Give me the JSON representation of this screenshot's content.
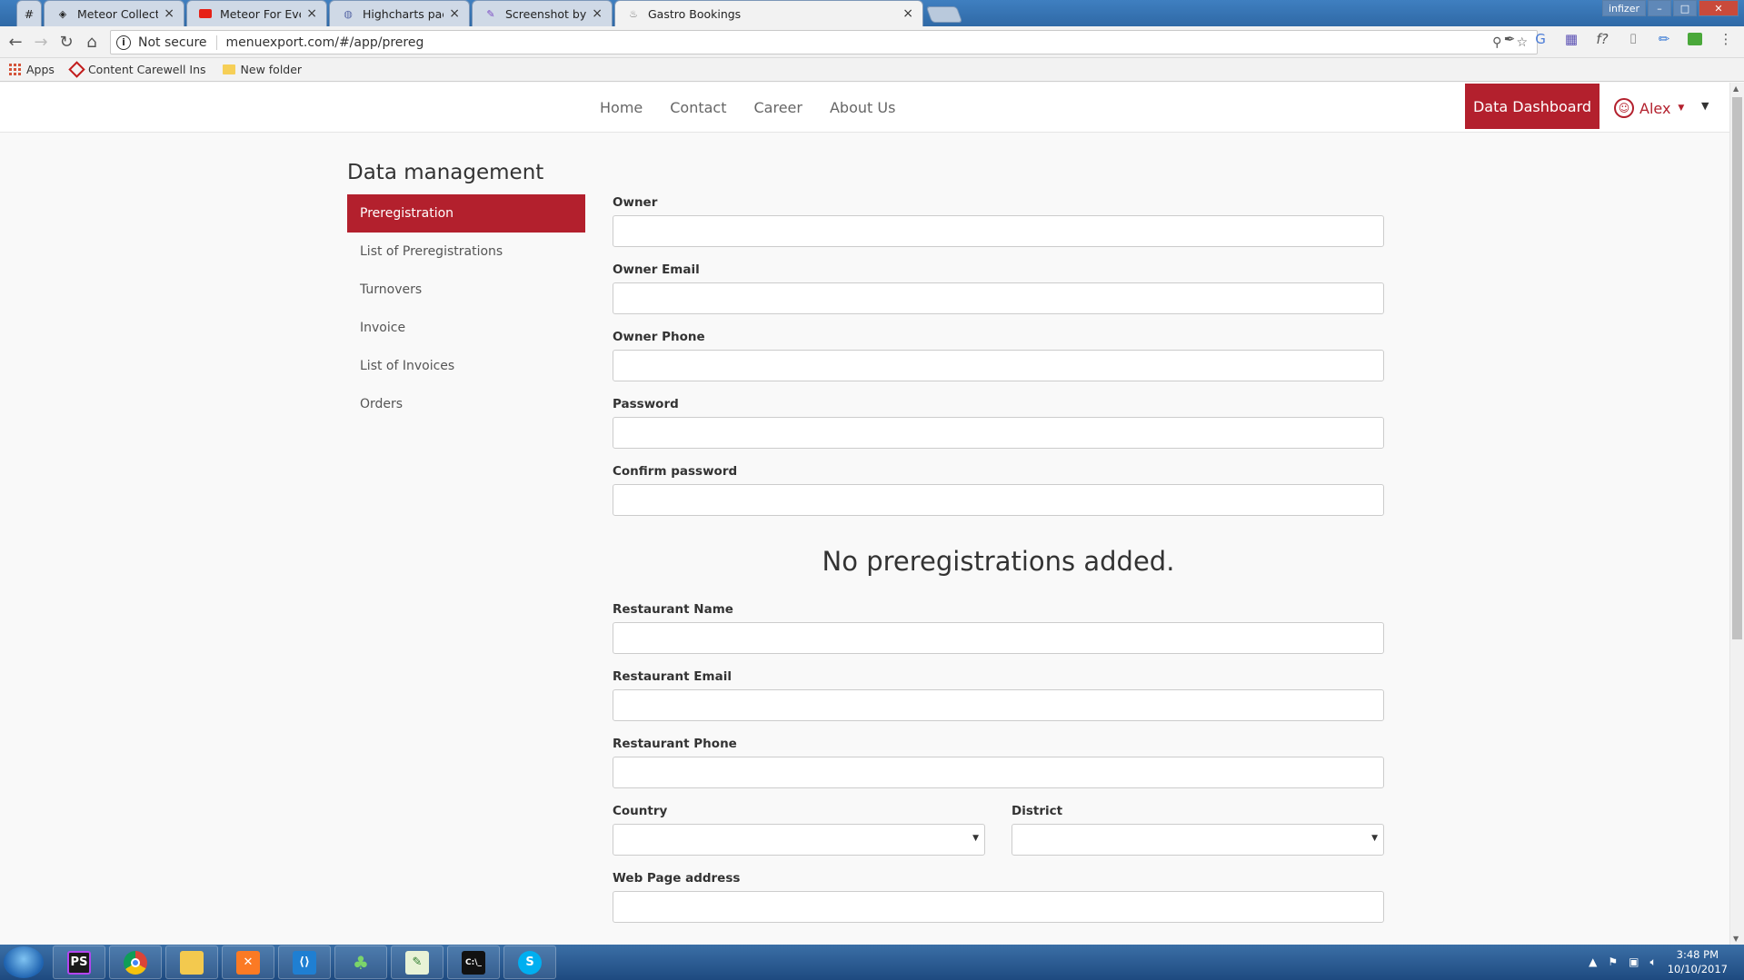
{
  "browser": {
    "tabs": [
      {
        "title": "#",
        "icon": "hash-icon"
      },
      {
        "title": "Meteor Collections",
        "icon": "meteor-icon"
      },
      {
        "title": "Meteor For Everyone Tut",
        "icon": "youtube-icon"
      },
      {
        "title": "Highcharts packages | At",
        "icon": "atmosphere-icon"
      },
      {
        "title": "Screenshot by Lightshot",
        "icon": "feather-icon"
      },
      {
        "title": "Gastro Bookings",
        "icon": "gastro-icon",
        "active": true
      }
    ],
    "window_user": "infizer",
    "security_label": "Not secure",
    "url": "menuexport.com/#/app/prereg",
    "bookmarks": {
      "apps": "Apps",
      "items": [
        "Content Carewell Ins",
        "New folder"
      ]
    }
  },
  "navbar": {
    "links": [
      "Home",
      "Contact",
      "Career",
      "About Us"
    ],
    "dashboard_button": "Data Dashboard",
    "user_name": "Alex"
  },
  "page": {
    "title": "Data management",
    "sidebar": [
      {
        "label": "Preregistration",
        "active": true
      },
      {
        "label": "List of Preregistrations"
      },
      {
        "label": "Turnovers"
      },
      {
        "label": "Invoice"
      },
      {
        "label": "List of Invoices"
      },
      {
        "label": "Orders"
      }
    ],
    "form": {
      "owner_label": "Owner",
      "owner_email_label": "Owner Email",
      "owner_phone_label": "Owner Phone",
      "password_label": "Password",
      "confirm_password_label": "Confirm password",
      "empty_message": "No preregistrations added.",
      "restaurant_name_label": "Restaurant Name",
      "restaurant_email_label": "Restaurant Email",
      "restaurant_phone_label": "Restaurant Phone",
      "country_label": "Country",
      "district_label": "District",
      "web_page_label": "Web Page address"
    }
  },
  "taskbar": {
    "time": "3:48 PM",
    "date": "10/10/2017"
  },
  "colors": {
    "accent": "#b3202d"
  }
}
